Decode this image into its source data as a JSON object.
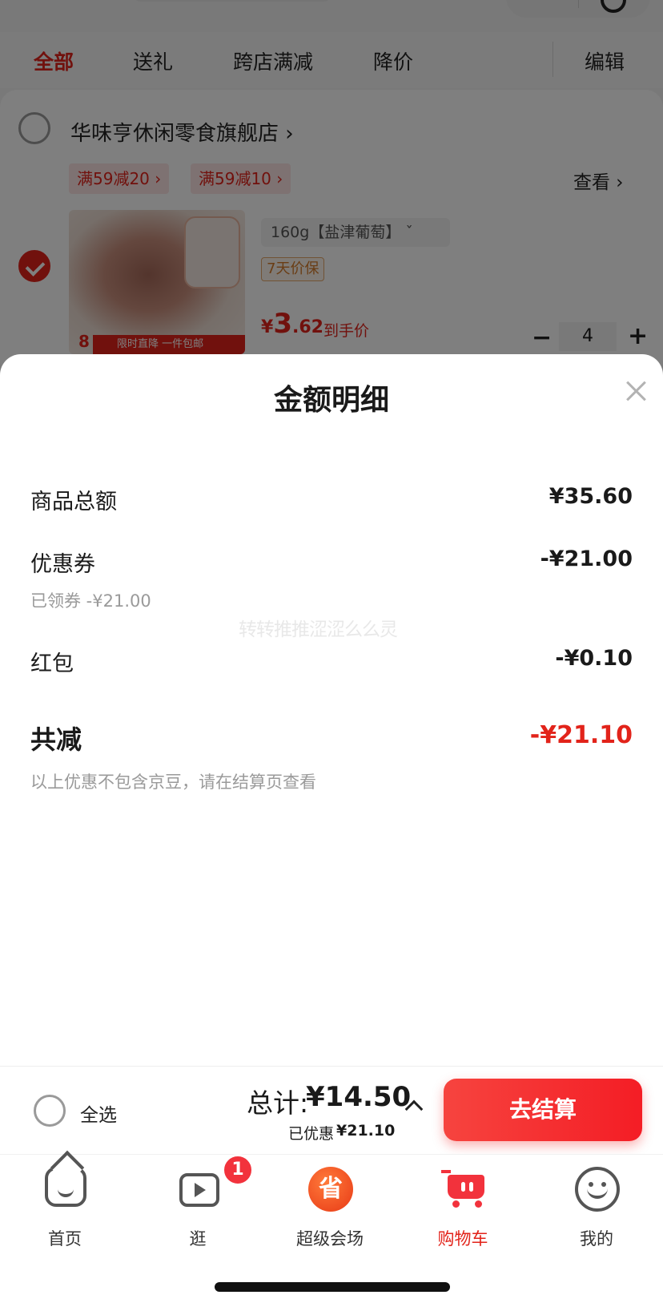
{
  "cart_page": {
    "filters": [
      "全部",
      "送礼",
      "跨店满减",
      "降价"
    ],
    "edit_label": "编辑",
    "store": {
      "name": "华味亨休闲零食旗舰店 ›",
      "promos": [
        "满59减20 ›",
        "满59减10 ›"
      ],
      "view_more": "查看 ›"
    },
    "item": {
      "spec": "160g【盐津葡萄】 ˇ",
      "price_guard": "7天价保",
      "price_symbol": "¥",
      "price_int": "3",
      "price_dec": ".62",
      "price_note": "到手价",
      "quantity": "4",
      "thumb_num": "8",
      "thumb_banner": "限时直降 一件包邮"
    }
  },
  "sheet": {
    "title": "金额明细",
    "rows": [
      {
        "label": "商品总额",
        "value": "¥35.60"
      },
      {
        "label": "优惠券",
        "value": "-¥21.00",
        "sub": "已领券 -¥21.00"
      },
      {
        "label": "红包",
        "value": "-¥0.10"
      }
    ],
    "total_label": "共减",
    "total_value": "-¥21.10",
    "note": "以上优惠不包含京豆，请在结算页查看",
    "watermark": "转转推推涩涩么么灵"
  },
  "checkout": {
    "select_all": "全选",
    "sum_label": "总计:",
    "sum_value": "¥14.50",
    "saved_label": "已优惠",
    "saved_value": "¥21.10",
    "button": "去结算"
  },
  "nav": {
    "items": [
      {
        "label": "首页",
        "icon": "home-icon"
      },
      {
        "label": "逛",
        "icon": "video-icon",
        "badge": "1"
      },
      {
        "label": "超级会场",
        "icon": "super-venue-icon",
        "glyph": "省"
      },
      {
        "label": "购物车",
        "icon": "cart-icon"
      },
      {
        "label": "我的",
        "icon": "profile-icon"
      }
    ],
    "accent": "#e2231a"
  }
}
